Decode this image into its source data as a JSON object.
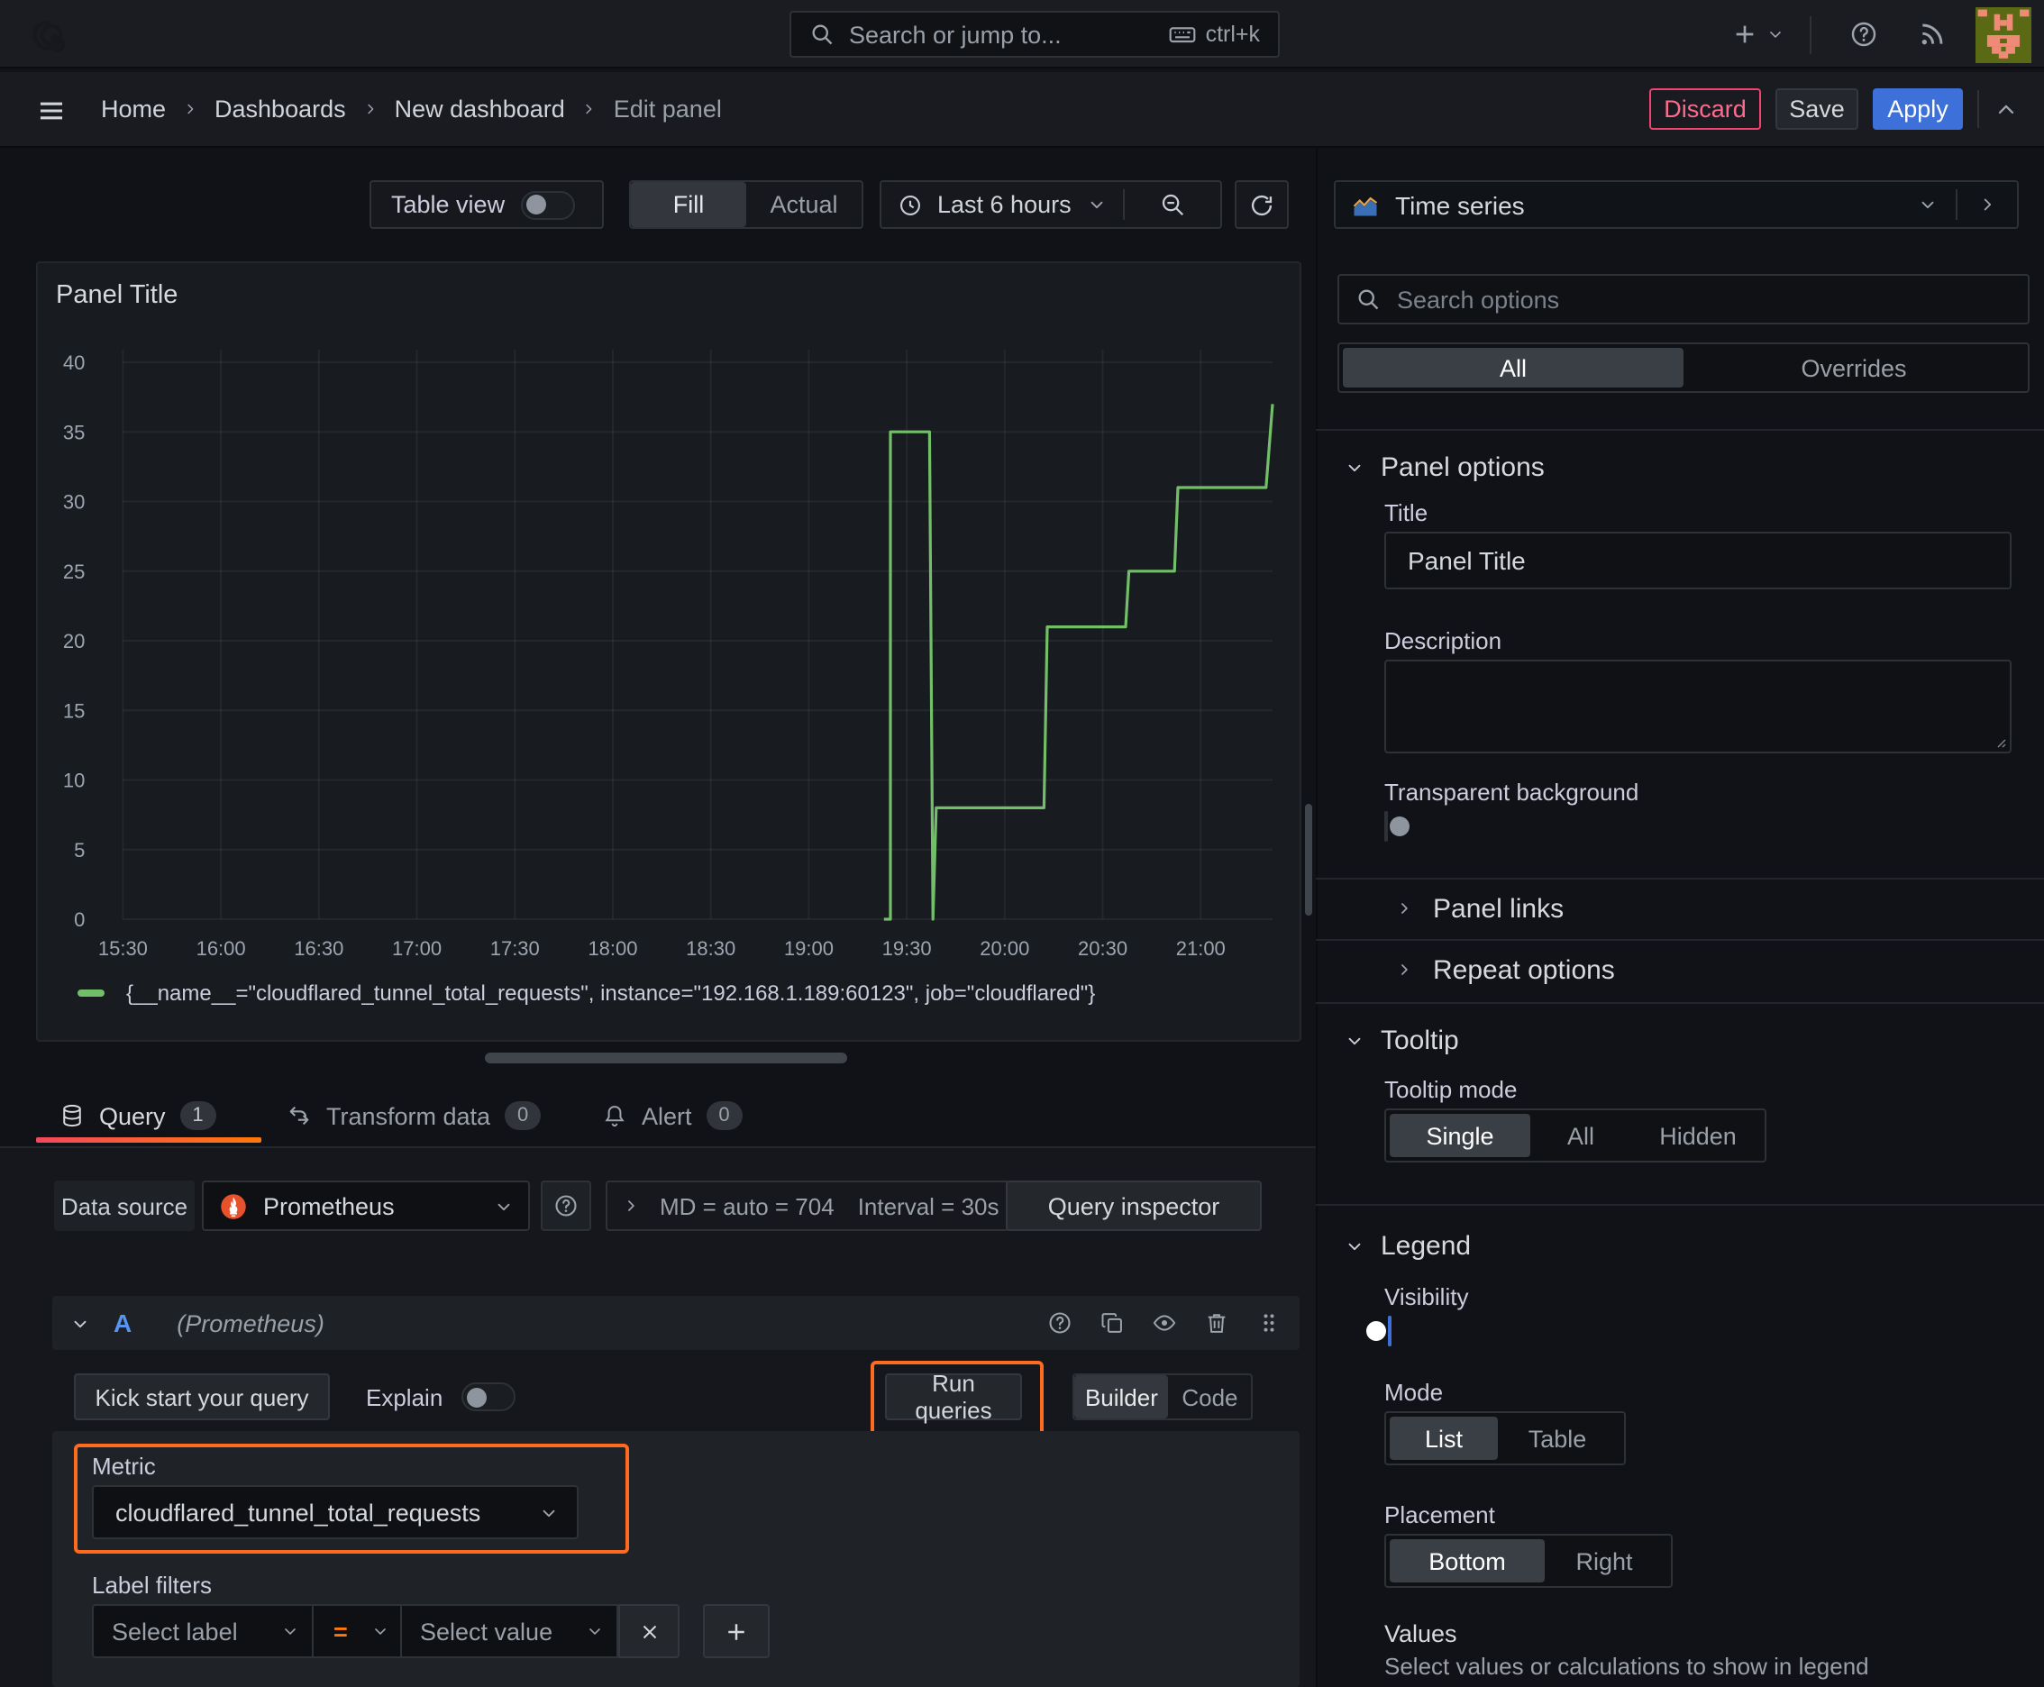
{
  "topbar": {
    "search_placeholder": "Search or jump to...",
    "shortcut": "ctrl+k"
  },
  "breadcrumb": {
    "items": [
      "Home",
      "Dashboards",
      "New dashboard",
      "Edit panel"
    ]
  },
  "actions": {
    "discard": "Discard",
    "save": "Save",
    "apply": "Apply"
  },
  "toolbar": {
    "table_view": "Table view",
    "fill": "Fill",
    "actual": "Actual",
    "time_range": "Last 6 hours"
  },
  "viz_picker": {
    "value": "Time series"
  },
  "panel": {
    "title": "Panel Title",
    "legend": "{__name__=\"cloudflared_tunnel_total_requests\", instance=\"192.168.1.189:60123\", job=\"cloudflared\"}"
  },
  "chart_data": {
    "type": "line",
    "title": "Panel Title",
    "x_axis_note": "time of day; minutes measured from 15:30; plot spans 15:30 to about 21:22",
    "x_range_minutes": [
      0,
      352
    ],
    "x_ticks": [
      {
        "t": 0,
        "label": "15:30"
      },
      {
        "t": 30,
        "label": "16:00"
      },
      {
        "t": 60,
        "label": "16:30"
      },
      {
        "t": 90,
        "label": "17:00"
      },
      {
        "t": 120,
        "label": "17:30"
      },
      {
        "t": 150,
        "label": "18:00"
      },
      {
        "t": 180,
        "label": "18:30"
      },
      {
        "t": 210,
        "label": "19:00"
      },
      {
        "t": 240,
        "label": "19:30"
      },
      {
        "t": 270,
        "label": "20:00"
      },
      {
        "t": 300,
        "label": "20:30"
      },
      {
        "t": 330,
        "label": "21:00"
      }
    ],
    "ylim": [
      0,
      40
    ],
    "y_ticks": [
      0,
      5,
      10,
      15,
      20,
      25,
      30,
      35,
      40
    ],
    "grid": true,
    "legend_position": "bottom",
    "series": [
      {
        "name": "{__name__=\"cloudflared_tunnel_total_requests\", instance=\"192.168.1.189:60123\", job=\"cloudflared\"}",
        "color": "#73bf69",
        "points": [
          [
            233,
            0
          ],
          [
            235,
            0
          ],
          [
            235,
            35
          ],
          [
            247,
            35
          ],
          [
            248,
            0
          ],
          [
            249,
            8
          ],
          [
            282,
            8
          ],
          [
            283,
            21
          ],
          [
            307,
            21
          ],
          [
            308,
            25
          ],
          [
            322,
            25
          ],
          [
            323,
            31
          ],
          [
            350,
            31
          ],
          [
            352,
            37
          ]
        ]
      }
    ]
  },
  "tabs": [
    {
      "label": "Query",
      "count": "1"
    },
    {
      "label": "Transform data",
      "count": "0"
    },
    {
      "label": "Alert",
      "count": "0"
    }
  ],
  "datasource_bar": {
    "label": "Data source",
    "value": "Prometheus",
    "stat_md": "MD = auto = 704",
    "stat_interval": "Interval = 30s",
    "query_inspector": "Query inspector"
  },
  "query": {
    "ref_id": "A",
    "ds_hint": "(Prometheus)",
    "kick_start": "Kick start your query",
    "explain": "Explain",
    "run_queries": "Run queries",
    "builder": "Builder",
    "code": "Code",
    "metric_label": "Metric",
    "metric_value": "cloudflared_tunnel_total_requests",
    "label_filters": "Label filters",
    "select_label_placeholder": "Select label",
    "operator": "=",
    "select_value_placeholder": "Select value"
  },
  "options": {
    "search_placeholder": "Search options",
    "tab_all": "All",
    "tab_overrides": "Overrides",
    "panel_options": {
      "title": "Panel options",
      "title_label": "Title",
      "title_value": "Panel Title",
      "description_label": "Description",
      "transparent_label": "Transparent background",
      "transparent_on": false,
      "panel_links": "Panel links",
      "repeat_options": "Repeat options"
    },
    "tooltip": {
      "title": "Tooltip",
      "mode_label": "Tooltip mode",
      "mode_single": "Single",
      "mode_all": "All",
      "mode_hidden": "Hidden",
      "selected": "Single"
    },
    "legend": {
      "title": "Legend",
      "visibility_label": "Visibility",
      "visibility_on": true,
      "mode_label": "Mode",
      "mode_list": "List",
      "mode_table": "Table",
      "selected_mode": "List",
      "placement_label": "Placement",
      "placement_bottom": "Bottom",
      "placement_right": "Right",
      "selected_placement": "Bottom",
      "values_label": "Values",
      "values_hint": "Select values or calculations to show in legend"
    }
  },
  "colors": {
    "accent_blue": "#3d71d9",
    "highlight_orange": "#ff6a1f",
    "series_green": "#73bf69",
    "destructive_red": "#f0436f",
    "prometheus_orange": "#e6522c",
    "ref_id_blue": "#5794f2"
  }
}
